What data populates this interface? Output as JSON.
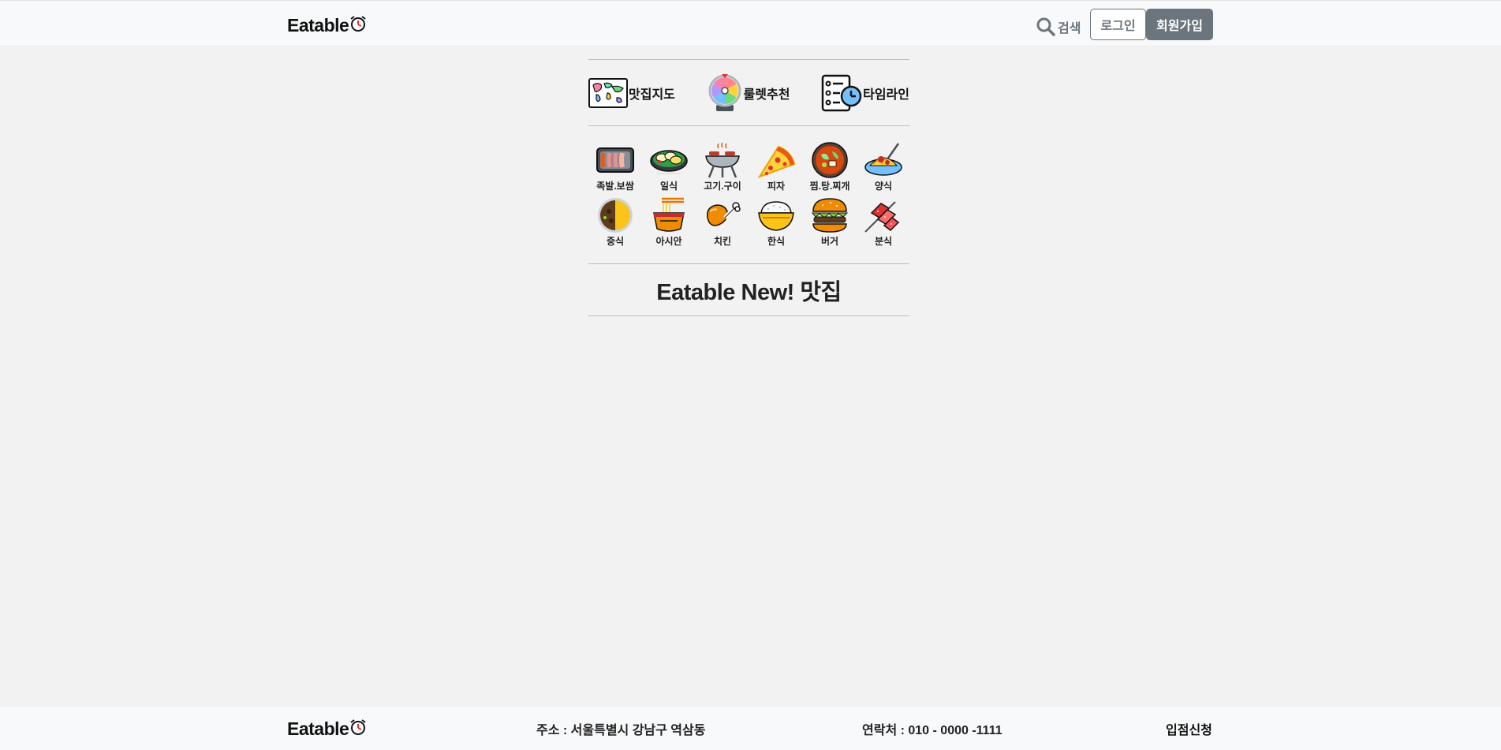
{
  "header": {
    "logo_text": "Eatable",
    "search_label": "검색",
    "login_label": "로그인",
    "signup_label": "회원가입"
  },
  "features": [
    {
      "label": "맛집지도",
      "icon": "world-map-icon"
    },
    {
      "label": "룰렛추천",
      "icon": "roulette-wheel-icon"
    },
    {
      "label": "타임라인",
      "icon": "timeline-checklist-icon"
    }
  ],
  "categories": [
    {
      "label": "족발.보쌈",
      "icon": "pork-slices-icon"
    },
    {
      "label": "일식",
      "icon": "sushi-plate-icon"
    },
    {
      "label": "고기.구이",
      "icon": "bbq-grill-icon"
    },
    {
      "label": "피자",
      "icon": "pizza-icon"
    },
    {
      "label": "찜.탕.찌개",
      "icon": "stew-bowl-icon"
    },
    {
      "label": "양식",
      "icon": "spaghetti-icon"
    },
    {
      "label": "중식",
      "icon": "jjajang-plate-icon"
    },
    {
      "label": "아시안",
      "icon": "noodle-bowl-icon"
    },
    {
      "label": "치킨",
      "icon": "chicken-leg-icon"
    },
    {
      "label": "한식",
      "icon": "rice-bowl-icon"
    },
    {
      "label": "버거",
      "icon": "burger-icon"
    },
    {
      "label": "분식",
      "icon": "fish-cake-skewer-icon"
    }
  ],
  "section": {
    "new_title": "Eatable New! 맛집"
  },
  "footer": {
    "logo_text": "Eatable",
    "address": "주소 : 서울특별시 강남구 역삼동",
    "contact": "연락처 : 010 - 0000 -1111",
    "apply_label": "입점신청"
  },
  "colors": {
    "page_bg": "#f2f2f2",
    "header_bg": "#f8f9fa",
    "button_gray": "#6c757d",
    "alarm_red": "#e03131"
  }
}
